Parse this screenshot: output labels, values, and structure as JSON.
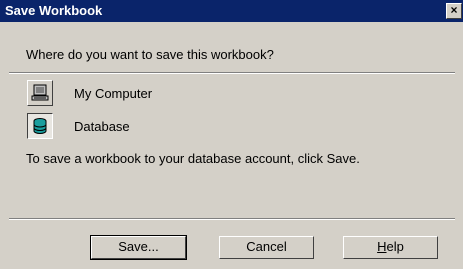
{
  "window": {
    "title": "Save Workbook",
    "close_label": "×"
  },
  "dialog": {
    "question": "Where do you want to save this workbook?",
    "options": [
      {
        "label": "My Computer",
        "icon": "computer-icon",
        "selected": false
      },
      {
        "label": "Database",
        "icon": "database-icon",
        "selected": true
      }
    ],
    "info": "To save a workbook to your database account, click Save."
  },
  "buttons": {
    "save": "Save...",
    "cancel": "Cancel",
    "help": "Help"
  },
  "colors": {
    "titlebar": "#0a246a",
    "face": "#d4d0c8",
    "database_icon": "#1a9e9e"
  }
}
